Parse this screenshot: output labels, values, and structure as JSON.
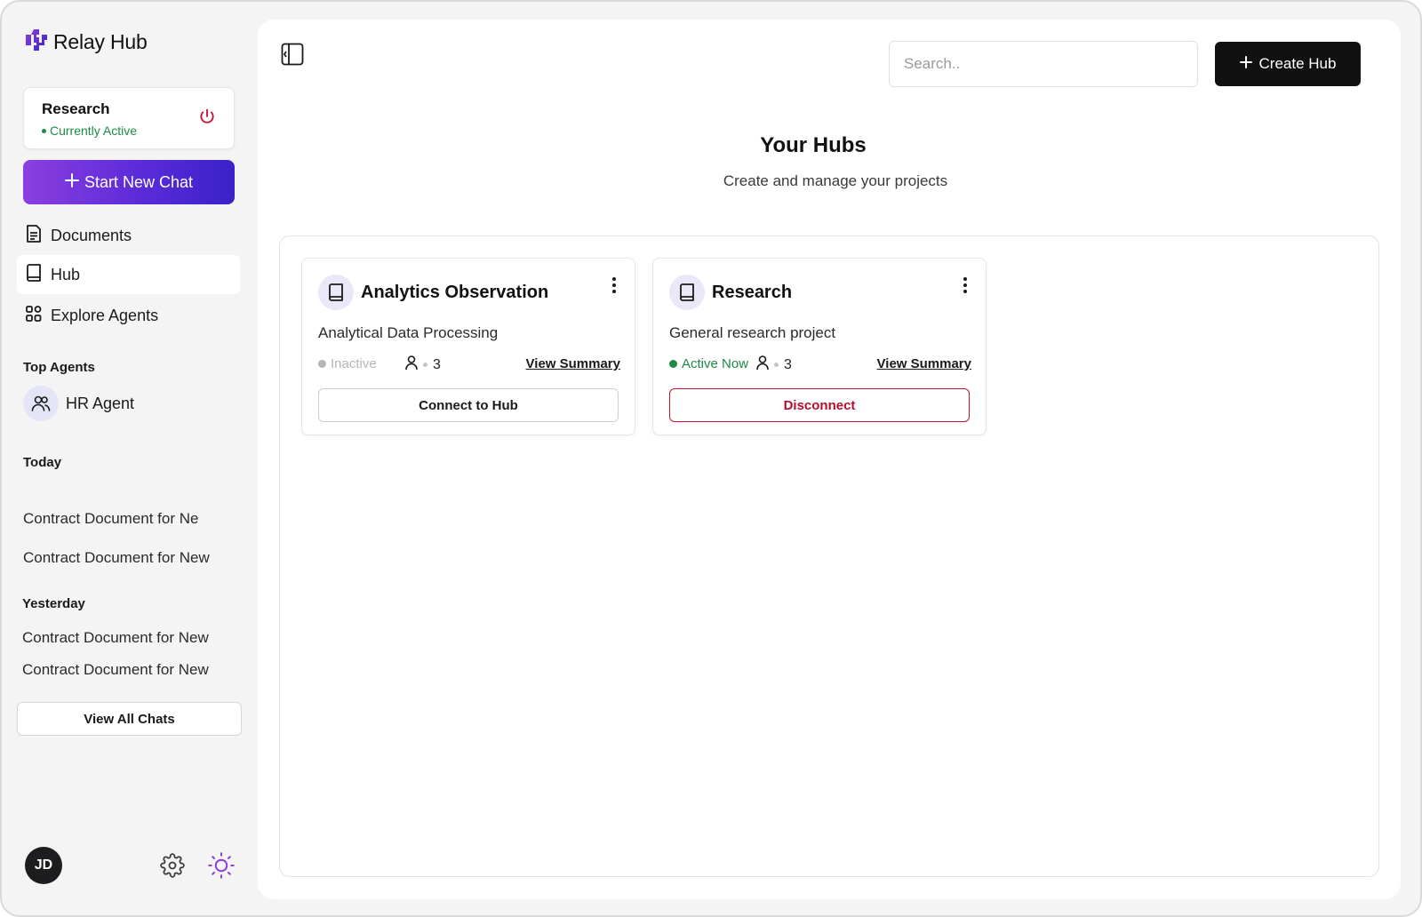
{
  "app": {
    "name": "Relay Hub"
  },
  "active_hub": {
    "name": "Research",
    "status": "Currently Active"
  },
  "sidebar": {
    "new_chat_label": "Start New Chat",
    "nav": [
      {
        "label": "Documents",
        "icon": "document-icon"
      },
      {
        "label": "Hub",
        "icon": "book-icon",
        "selected": true
      },
      {
        "label": "Explore Agents",
        "icon": "grid-icon"
      }
    ],
    "top_agents_label": "Top Agents",
    "agents": [
      {
        "name": "HR Agent",
        "icon": "users-icon"
      }
    ],
    "today_label": "Today",
    "today_chats": [
      "Contract Document for Ne",
      "Contract Document for New"
    ],
    "yesterday_label": "Yesterday",
    "yesterday_chats": [
      "Contract Document for New",
      "Contract Document for New"
    ],
    "view_all_label": "View All Chats",
    "user_initials": "JD"
  },
  "header": {
    "search_placeholder": "Search..",
    "create_label": "Create Hub"
  },
  "page": {
    "title": "Your Hubs",
    "subtitle": "Create and manage your projects"
  },
  "hubs": [
    {
      "title": "Analytics Observation",
      "description": "Analytical Data Processing",
      "status": "Inactive",
      "status_color": "#b5b5b9",
      "members": "3",
      "summary_label": "View Summary",
      "action_label": "Connect to Hub"
    },
    {
      "title": "Research",
      "description": "General research project",
      "status": "Active Now",
      "status_color": "#1e8a45",
      "members": "3",
      "summary_label": "View Summary",
      "action_label": "Disconnect"
    }
  ],
  "colors": {
    "accent_gradient_start": "#8b3fe0",
    "accent_gradient_end": "#3a22c8",
    "active_green": "#1e8a45",
    "danger_red": "#c8102e"
  }
}
